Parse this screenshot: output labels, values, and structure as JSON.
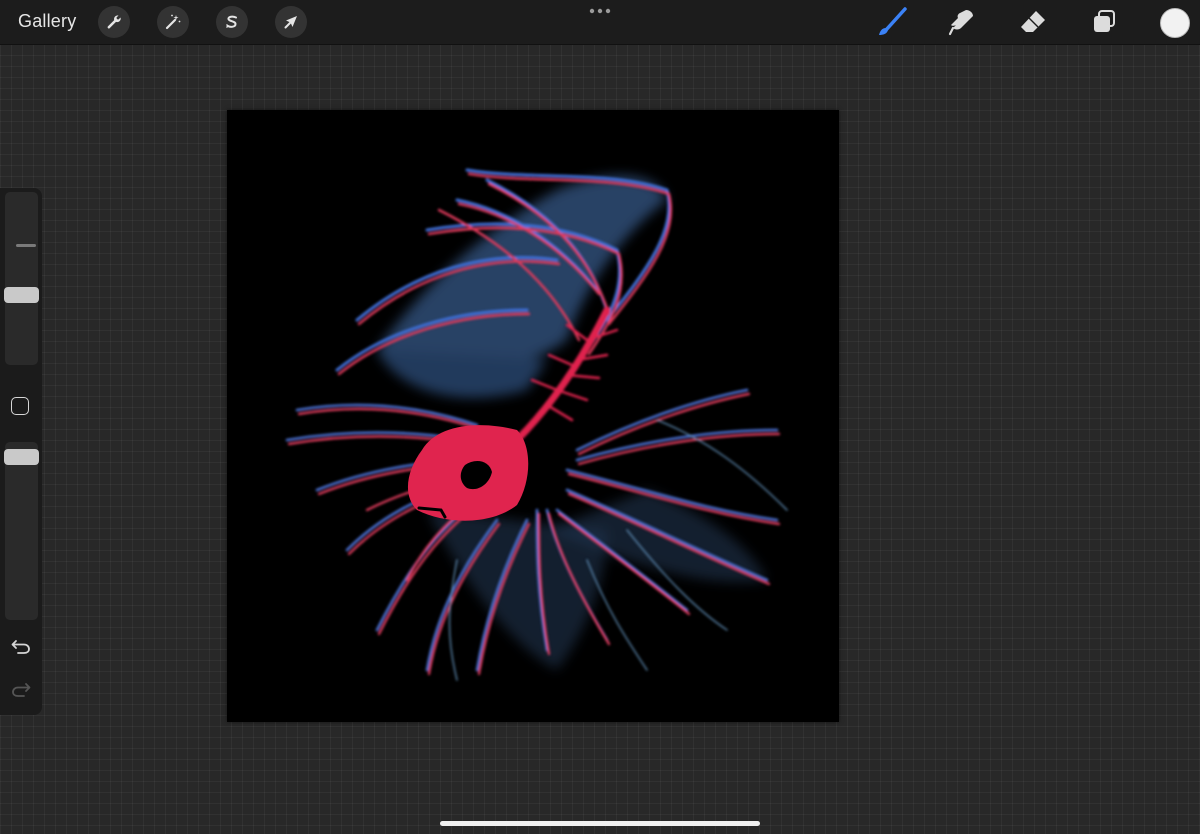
{
  "app": {
    "gallery_label": "Gallery"
  },
  "toolbar": {
    "left_tools": [
      {
        "name": "actions",
        "icon": "wrench-icon"
      },
      {
        "name": "adjustments",
        "icon": "magic-wand-icon"
      },
      {
        "name": "selection",
        "icon": "selection-s-icon"
      },
      {
        "name": "transform",
        "icon": "arrow-cursor-icon"
      }
    ],
    "more_icon": "more-dots-icon",
    "right_tools": [
      {
        "name": "brush",
        "icon": "brush-icon",
        "active": true
      },
      {
        "name": "smudge",
        "icon": "smudge-finger-icon",
        "active": false
      },
      {
        "name": "eraser",
        "icon": "eraser-icon",
        "active": false
      },
      {
        "name": "layers",
        "icon": "layers-icon",
        "active": false
      }
    ],
    "active_color": "#f2f2f2",
    "accent_color": "#3b82f6"
  },
  "sidebar": {
    "brush_size_icon": "size-tick-icon",
    "modify_icon": "square-modify-icon",
    "undo_icon": "undo-icon",
    "redo_icon": "redo-icon"
  },
  "artwork": {
    "description_colors": {
      "primary": "#e0244e",
      "secondary": "#4a78c2",
      "tertiary": "#6aa0c8",
      "background": "#000000"
    }
  }
}
